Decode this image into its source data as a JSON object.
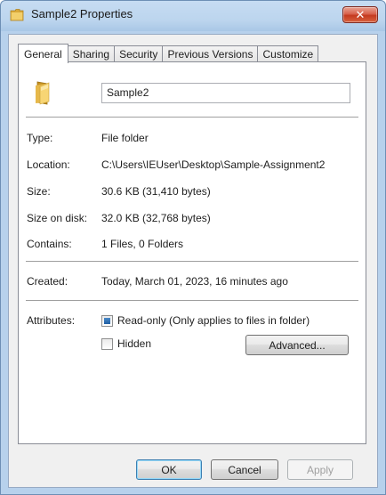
{
  "window": {
    "title": "Sample2 Properties",
    "close_glyph": "✕"
  },
  "tabs": [
    {
      "label": "General",
      "active": true
    },
    {
      "label": "Sharing",
      "active": false
    },
    {
      "label": "Security",
      "active": false
    },
    {
      "label": "Previous Versions",
      "active": false
    },
    {
      "label": "Customize",
      "active": false
    }
  ],
  "general": {
    "folder_name": "Sample2",
    "rows": {
      "type": {
        "label": "Type:",
        "value": "File folder"
      },
      "location": {
        "label": "Location:",
        "value": "C:\\Users\\IEUser\\Desktop\\Sample-Assignment2"
      },
      "size": {
        "label": "Size:",
        "value": "30.6 KB (31,410 bytes)"
      },
      "size_on_disk": {
        "label": "Size on disk:",
        "value": "32.0 KB (32,768 bytes)"
      },
      "contains": {
        "label": "Contains:",
        "value": "1 Files, 0 Folders"
      },
      "created": {
        "label": "Created:",
        "value": "Today, March 01, 2023, 16 minutes ago"
      }
    },
    "attributes": {
      "label": "Attributes:",
      "readonly": {
        "label": "Read-only (Only applies to files in folder)",
        "state": "indeterminate"
      },
      "hidden": {
        "label": "Hidden",
        "state": "unchecked"
      },
      "advanced_label": "Advanced..."
    }
  },
  "footer": {
    "ok_label": "OK",
    "cancel_label": "Cancel",
    "apply_label": "Apply"
  },
  "icons": {
    "title_icon": "folder-icon",
    "large_icon": "folder-icon"
  },
  "colors": {
    "title_bar": "#bcd5ee",
    "close_button": "#c43a1f",
    "checkbox_fill": "#1f5ea3"
  }
}
